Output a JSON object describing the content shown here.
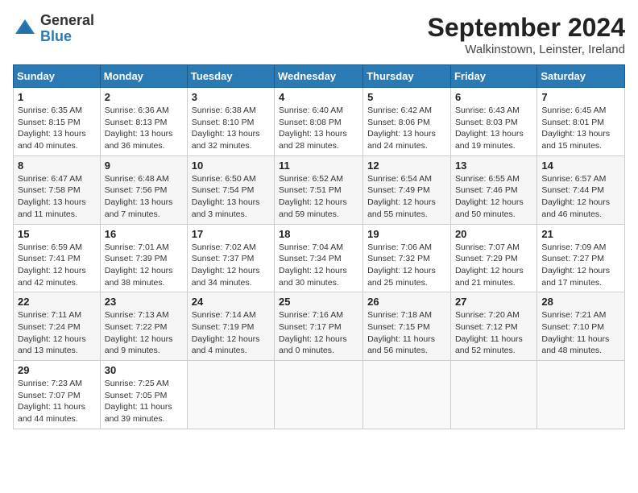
{
  "header": {
    "logo": {
      "general": "General",
      "blue": "Blue"
    },
    "title": "September 2024",
    "subtitle": "Walkinstown, Leinster, Ireland"
  },
  "calendar": {
    "days_of_week": [
      "Sunday",
      "Monday",
      "Tuesday",
      "Wednesday",
      "Thursday",
      "Friday",
      "Saturday"
    ],
    "weeks": [
      [
        {
          "day": "1",
          "sunrise": "Sunrise: 6:35 AM",
          "sunset": "Sunset: 8:15 PM",
          "daylight": "Daylight: 13 hours and 40 minutes."
        },
        {
          "day": "2",
          "sunrise": "Sunrise: 6:36 AM",
          "sunset": "Sunset: 8:13 PM",
          "daylight": "Daylight: 13 hours and 36 minutes."
        },
        {
          "day": "3",
          "sunrise": "Sunrise: 6:38 AM",
          "sunset": "Sunset: 8:10 PM",
          "daylight": "Daylight: 13 hours and 32 minutes."
        },
        {
          "day": "4",
          "sunrise": "Sunrise: 6:40 AM",
          "sunset": "Sunset: 8:08 PM",
          "daylight": "Daylight: 13 hours and 28 minutes."
        },
        {
          "day": "5",
          "sunrise": "Sunrise: 6:42 AM",
          "sunset": "Sunset: 8:06 PM",
          "daylight": "Daylight: 13 hours and 24 minutes."
        },
        {
          "day": "6",
          "sunrise": "Sunrise: 6:43 AM",
          "sunset": "Sunset: 8:03 PM",
          "daylight": "Daylight: 13 hours and 19 minutes."
        },
        {
          "day": "7",
          "sunrise": "Sunrise: 6:45 AM",
          "sunset": "Sunset: 8:01 PM",
          "daylight": "Daylight: 13 hours and 15 minutes."
        }
      ],
      [
        {
          "day": "8",
          "sunrise": "Sunrise: 6:47 AM",
          "sunset": "Sunset: 7:58 PM",
          "daylight": "Daylight: 13 hours and 11 minutes."
        },
        {
          "day": "9",
          "sunrise": "Sunrise: 6:48 AM",
          "sunset": "Sunset: 7:56 PM",
          "daylight": "Daylight: 13 hours and 7 minutes."
        },
        {
          "day": "10",
          "sunrise": "Sunrise: 6:50 AM",
          "sunset": "Sunset: 7:54 PM",
          "daylight": "Daylight: 13 hours and 3 minutes."
        },
        {
          "day": "11",
          "sunrise": "Sunrise: 6:52 AM",
          "sunset": "Sunset: 7:51 PM",
          "daylight": "Daylight: 12 hours and 59 minutes."
        },
        {
          "day": "12",
          "sunrise": "Sunrise: 6:54 AM",
          "sunset": "Sunset: 7:49 PM",
          "daylight": "Daylight: 12 hours and 55 minutes."
        },
        {
          "day": "13",
          "sunrise": "Sunrise: 6:55 AM",
          "sunset": "Sunset: 7:46 PM",
          "daylight": "Daylight: 12 hours and 50 minutes."
        },
        {
          "day": "14",
          "sunrise": "Sunrise: 6:57 AM",
          "sunset": "Sunset: 7:44 PM",
          "daylight": "Daylight: 12 hours and 46 minutes."
        }
      ],
      [
        {
          "day": "15",
          "sunrise": "Sunrise: 6:59 AM",
          "sunset": "Sunset: 7:41 PM",
          "daylight": "Daylight: 12 hours and 42 minutes."
        },
        {
          "day": "16",
          "sunrise": "Sunrise: 7:01 AM",
          "sunset": "Sunset: 7:39 PM",
          "daylight": "Daylight: 12 hours and 38 minutes."
        },
        {
          "day": "17",
          "sunrise": "Sunrise: 7:02 AM",
          "sunset": "Sunset: 7:37 PM",
          "daylight": "Daylight: 12 hours and 34 minutes."
        },
        {
          "day": "18",
          "sunrise": "Sunrise: 7:04 AM",
          "sunset": "Sunset: 7:34 PM",
          "daylight": "Daylight: 12 hours and 30 minutes."
        },
        {
          "day": "19",
          "sunrise": "Sunrise: 7:06 AM",
          "sunset": "Sunset: 7:32 PM",
          "daylight": "Daylight: 12 hours and 25 minutes."
        },
        {
          "day": "20",
          "sunrise": "Sunrise: 7:07 AM",
          "sunset": "Sunset: 7:29 PM",
          "daylight": "Daylight: 12 hours and 21 minutes."
        },
        {
          "day": "21",
          "sunrise": "Sunrise: 7:09 AM",
          "sunset": "Sunset: 7:27 PM",
          "daylight": "Daylight: 12 hours and 17 minutes."
        }
      ],
      [
        {
          "day": "22",
          "sunrise": "Sunrise: 7:11 AM",
          "sunset": "Sunset: 7:24 PM",
          "daylight": "Daylight: 12 hours and 13 minutes."
        },
        {
          "day": "23",
          "sunrise": "Sunrise: 7:13 AM",
          "sunset": "Sunset: 7:22 PM",
          "daylight": "Daylight: 12 hours and 9 minutes."
        },
        {
          "day": "24",
          "sunrise": "Sunrise: 7:14 AM",
          "sunset": "Sunset: 7:19 PM",
          "daylight": "Daylight: 12 hours and 4 minutes."
        },
        {
          "day": "25",
          "sunrise": "Sunrise: 7:16 AM",
          "sunset": "Sunset: 7:17 PM",
          "daylight": "Daylight: 12 hours and 0 minutes."
        },
        {
          "day": "26",
          "sunrise": "Sunrise: 7:18 AM",
          "sunset": "Sunset: 7:15 PM",
          "daylight": "Daylight: 11 hours and 56 minutes."
        },
        {
          "day": "27",
          "sunrise": "Sunrise: 7:20 AM",
          "sunset": "Sunset: 7:12 PM",
          "daylight": "Daylight: 11 hours and 52 minutes."
        },
        {
          "day": "28",
          "sunrise": "Sunrise: 7:21 AM",
          "sunset": "Sunset: 7:10 PM",
          "daylight": "Daylight: 11 hours and 48 minutes."
        }
      ],
      [
        {
          "day": "29",
          "sunrise": "Sunrise: 7:23 AM",
          "sunset": "Sunset: 7:07 PM",
          "daylight": "Daylight: 11 hours and 44 minutes."
        },
        {
          "day": "30",
          "sunrise": "Sunrise: 7:25 AM",
          "sunset": "Sunset: 7:05 PM",
          "daylight": "Daylight: 11 hours and 39 minutes."
        },
        null,
        null,
        null,
        null,
        null
      ]
    ]
  }
}
